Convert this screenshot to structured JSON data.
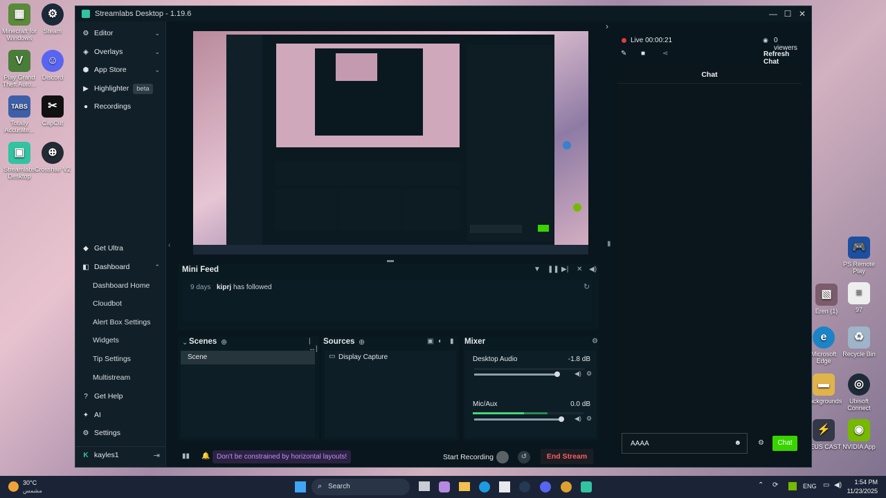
{
  "desktop": {
    "left_icons": [
      {
        "label": "Minecraft for Windows",
        "icon": "minecraft-icon",
        "color": "#5b8a3a"
      },
      {
        "label": "Steam",
        "icon": "steam-icon",
        "color": "#1b2838"
      },
      {
        "label": "Play Grand Theft Auto...",
        "icon": "gta-icon",
        "color": "#4a7d3a"
      },
      {
        "label": "Discord",
        "icon": "discord-icon",
        "color": "#5865f2"
      },
      {
        "label": "Totally Accurate...",
        "icon": "tabs-icon",
        "color": "#3d5fa8"
      },
      {
        "label": "CapCut",
        "icon": "capcut-icon",
        "color": "#111111"
      },
      {
        "label": "Streamlabs Desktop",
        "icon": "streamlabs-icon",
        "color": "#31c3a2"
      },
      {
        "label": "Crosshair V2",
        "icon": "crosshair-icon",
        "color": "#222a33"
      }
    ],
    "right_icons": [
      {
        "label": "PS Remote Play",
        "icon": "ps-remote-icon",
        "color": "#1c4fa0"
      },
      {
        "label": "Eren (1)",
        "icon": "image-icon",
        "color": "#7a5c6c"
      },
      {
        "label": "97",
        "icon": "file-icon",
        "color": "#eeeeee"
      },
      {
        "label": "Microsoft Edge",
        "icon": "edge-icon",
        "color": "#1b84c7"
      },
      {
        "label": "Recycle Bin",
        "icon": "recycle-bin-icon",
        "color": "#9fb4c8"
      },
      {
        "label": "Backgrounds",
        "icon": "folder-icon",
        "color": "#e0b44a"
      },
      {
        "label": "Ubisoft Connect",
        "icon": "ubisoft-icon",
        "color": "#1e2a37"
      },
      {
        "label": "ZEUS CAST",
        "icon": "zeus-icon",
        "color": "#333848"
      },
      {
        "label": "NVIDIA App",
        "icon": "nvidia-icon",
        "color": "#76b900"
      }
    ]
  },
  "window": {
    "title": "Streamlabs Desktop - 1.19.6"
  },
  "sidebar": {
    "top_items": [
      {
        "label": "Editor",
        "icon": "editor-icon"
      },
      {
        "label": "Overlays",
        "icon": "overlays-icon"
      },
      {
        "label": "App Store",
        "icon": "app-store-icon"
      },
      {
        "label": "Highlighter",
        "icon": "highlighter-icon",
        "badge": "beta"
      },
      {
        "label": "Recordings",
        "icon": "recordings-icon"
      }
    ],
    "get_ultra": "Get Ultra",
    "dashboard": "Dashboard",
    "dashboard_items": [
      "Dashboard Home",
      "Cloudbot",
      "Alert Box Settings",
      "Widgets",
      "Tip Settings",
      "Multistream"
    ],
    "get_help": "Get Help",
    "ai": "AI",
    "settings": "Settings",
    "user": "kayles1"
  },
  "mini_feed": {
    "title": "Mini Feed",
    "entry": {
      "time": "9 days",
      "user": "kiprj",
      "action": "has followed"
    }
  },
  "scenes": {
    "title": "Scenes",
    "items": [
      "Scene"
    ]
  },
  "sources": {
    "title": "Sources",
    "items": [
      "Display Capture"
    ]
  },
  "mixer": {
    "title": "Mixer",
    "channels": [
      {
        "name": "Desktop Audio",
        "db": "-1.8 dB",
        "level": 0.0,
        "volume": 0.9
      },
      {
        "name": "Mic/Aux",
        "db": "0.0 dB",
        "level": 0.6,
        "volume": 0.95
      }
    ]
  },
  "footer": {
    "promo": "Don't be constrained by horizontal layouts!",
    "start_recording": "Start Recording",
    "end_stream": "End Stream"
  },
  "live": {
    "status": "Live 00:00:21",
    "viewers": "0 viewers",
    "refresh_chat": "Refresh Chat",
    "chat_title": "Chat",
    "chat_input": "AAAA",
    "chat_button": "Chat"
  },
  "taskbar": {
    "weather_temp": "30°C",
    "weather_desc": "مشمس",
    "search": "Search",
    "lang": "ENG",
    "time": "1:54 PM",
    "date": "11/23/2025"
  },
  "colors": {
    "accent": "#31c3a2",
    "live_red": "#e23c3c",
    "chat_green": "#37d400",
    "promo_purple": "#c58cff",
    "end_stream_red": "#ff5d5d"
  }
}
